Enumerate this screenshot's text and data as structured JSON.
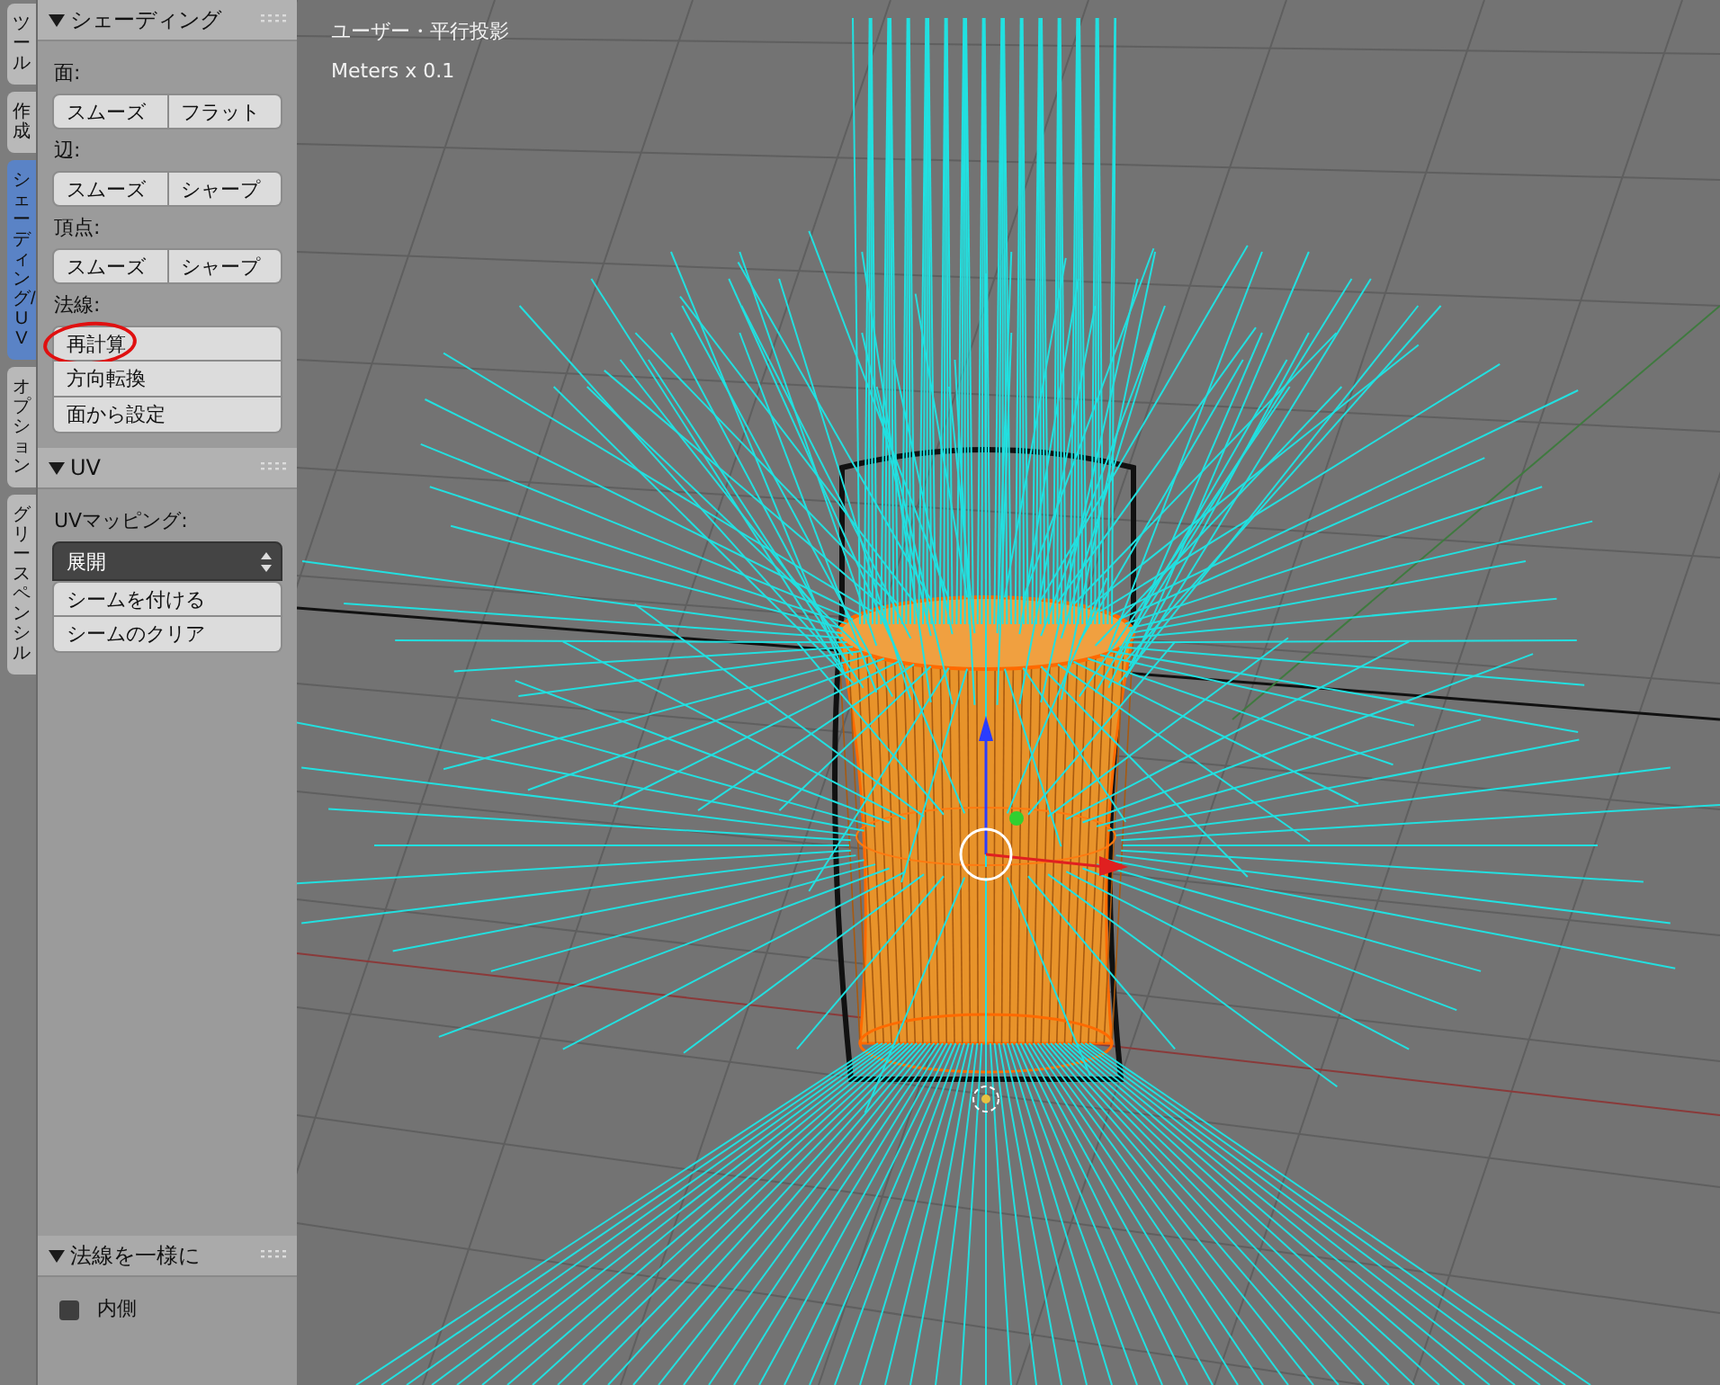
{
  "tabs": [
    {
      "label": "ツール",
      "selected": false
    },
    {
      "label": "作成",
      "selected": false
    },
    {
      "label": "シェーディング/UV",
      "selected": true
    },
    {
      "label": "オプション",
      "selected": false
    },
    {
      "label": "グリースペンシル",
      "selected": false
    }
  ],
  "panels": [
    {
      "title": "シェーディング",
      "expanded": true,
      "items": [
        {
          "kind": "label",
          "text": "面:"
        },
        {
          "kind": "pair",
          "buttons": [
            "スムーズ",
            "フラット"
          ]
        },
        {
          "kind": "label",
          "text": "辺:"
        },
        {
          "kind": "pair",
          "buttons": [
            "スムーズ",
            "シャープ"
          ]
        },
        {
          "kind": "label",
          "text": "頂点:"
        },
        {
          "kind": "pair",
          "buttons": [
            "スムーズ",
            "シャープ"
          ]
        },
        {
          "kind": "label",
          "text": "法線:"
        },
        {
          "kind": "column",
          "buttons": [
            {
              "label": "再計算",
              "circled": true
            },
            {
              "label": "方向転換",
              "circled": false
            },
            {
              "label": "面から設定",
              "circled": false
            }
          ]
        }
      ]
    },
    {
      "title": "UV",
      "expanded": true,
      "items": [
        {
          "kind": "label",
          "text": "UVマッピング:"
        },
        {
          "kind": "select",
          "value": "展開"
        },
        {
          "kind": "column",
          "buttons": [
            {
              "label": "シームを付ける",
              "circled": false
            },
            {
              "label": "シームのクリア",
              "circled": false
            }
          ]
        }
      ]
    }
  ],
  "operator": {
    "title": "法線を一様に",
    "expanded": true,
    "checkbox": {
      "label": "内側",
      "checked": false
    }
  },
  "viewport": {
    "view_label": "ユーザー・平行投影",
    "units": "Meters x 0.1"
  }
}
